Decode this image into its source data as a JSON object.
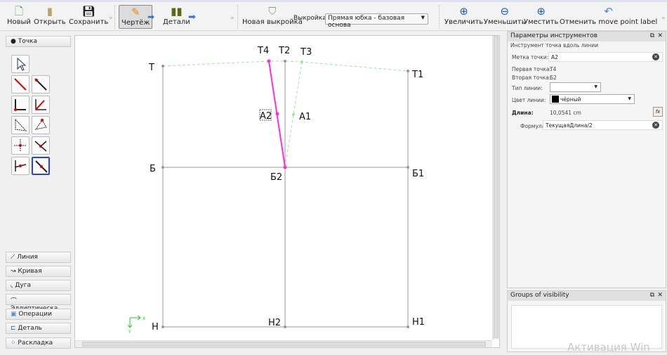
{
  "toolbar": {
    "new": "Новый",
    "open": "Открыть",
    "save": "Сохранить",
    "draw": "Чертёж",
    "details": "Детали",
    "new_pattern": "Новая выкройка",
    "pattern_label": "Выкройка:",
    "pattern_value": "Прямая юбка - базовая основа",
    "zoom_in": "Увеличить",
    "zoom_out": "Уменьшить",
    "fit": "Уместить",
    "undo": "Отменить move point label"
  },
  "left": {
    "point_tab": "Точка",
    "tabs": [
      "Линия",
      "Кривая",
      "Дуга",
      "Эллиптическа...",
      "Операции",
      "Деталь",
      "Раскладка"
    ]
  },
  "canvas": {
    "points": {
      "T": "Т",
      "T4": "Т4",
      "T2": "Т2",
      "T3": "Т3",
      "T1": "Т1",
      "A1": "А1",
      "A2": "А2",
      "B": "Б",
      "B2": "Б2",
      "B1": "Б1",
      "H": "Н",
      "H2": "Н2",
      "H1": "Н1"
    },
    "axis_x": "X",
    "axis_y": "Y"
  },
  "panel": {
    "title": "Параметры инструментов",
    "tool_title": "Инструмент точка вдоль линии",
    "label_label": "Метка точки:",
    "label_value": "А2",
    "first_label": "Первая точка:",
    "first_value": "Т4",
    "second_label": "Вторая точка:",
    "second_value": "Б2",
    "line_type_label": "Тип линии:",
    "line_color_label": "Цвет линии:",
    "line_color_value": "чёрный",
    "length_label": "Длина:",
    "length_value": "10,0541 cm",
    "formula_label": "Формула",
    "formula_value": "ТекущаяДлина/2",
    "fx": "fx"
  },
  "groups": {
    "title": "Groups of visibility"
  },
  "watermark": "Активация Win",
  "colors": {
    "accent": "#2a43e0",
    "selected_line": "#ff2dd8",
    "guide": "#9be89b"
  }
}
